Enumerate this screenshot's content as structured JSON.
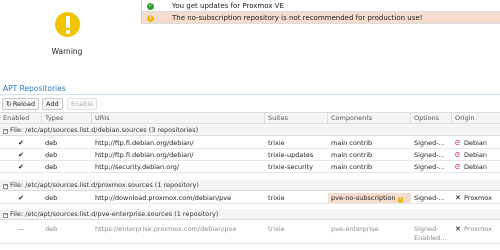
{
  "summary": {
    "status_label": "Warning",
    "messages": [
      {
        "level": "ok",
        "icon": "check-circle-icon",
        "text": "You get updates for Proxmox VE"
      },
      {
        "level": "warning",
        "icon": "warning-circle-icon",
        "text": "The no-subscription repository is not recommended for production use!"
      }
    ]
  },
  "section": {
    "title": "APT Repositories"
  },
  "toolbar": {
    "reload_label": "Reload",
    "add_label": "Add",
    "enable_label": "Enable"
  },
  "columns": {
    "enabled": "Enabled",
    "types": "Types",
    "uris": "URIs",
    "suites": "Suites",
    "components": "Components",
    "options": "Options",
    "origin": "Origin"
  },
  "groups": [
    {
      "label": "File: /etc/apt/sources.list.d/debian.sources (3 repositories)",
      "rows": [
        {
          "enabled": "✔",
          "type": "deb",
          "uri": "http://ftp.fi.debian.org/debian/",
          "suite": "trixie",
          "components": "main contrib",
          "options": "Signed-...",
          "origin": "Debian",
          "origin_icon": "debian-swirl-icon"
        },
        {
          "enabled": "✔",
          "type": "deb",
          "uri": "http://ftp.fi.debian.org/debian/",
          "suite": "trixie-updates",
          "components": "main contrib",
          "options": "Signed-...",
          "origin": "Debian",
          "origin_icon": "debian-swirl-icon"
        },
        {
          "enabled": "✔",
          "type": "deb",
          "uri": "http://security.debian.org/",
          "suite": "trixie-security",
          "components": "main contrib",
          "options": "Signed-...",
          "origin": "Debian",
          "origin_icon": "debian-swirl-icon"
        }
      ]
    },
    {
      "label": "File: /etc/apt/sources.list.d/proxmox.sources (1 repository)",
      "rows": [
        {
          "enabled": "✔",
          "type": "deb",
          "uri": "http://download.proxmox.com/debian/pve",
          "suite": "trixie",
          "components": "pve-no-subscription",
          "options": "Signed-...",
          "origin": "Proxmox",
          "origin_icon": "proxmox-x-icon",
          "components_warning": true
        }
      ]
    },
    {
      "label": "File: /etc/apt/sources.list.d/pve-enterprise.sources (1 repository)",
      "rows": [
        {
          "enabled": "—",
          "type": "deb",
          "uri": "https://enterprise.proxmox.com/debian/pve",
          "suite": "trixie",
          "components": "pve-enterprise",
          "options": "Signed-",
          "options_line2": "Enabled...",
          "origin": "Proxmox",
          "origin_icon": "proxmox-x-icon",
          "disabled": true
        }
      ]
    }
  ],
  "colors": {
    "warning_yellow": "#f3c400",
    "warning_row_bg": "#f5dccd",
    "ok_green": "#2aa02a",
    "title_blue": "#2d77bd",
    "debian_red": "#c70036",
    "proxmox_orange": "#e57000"
  }
}
